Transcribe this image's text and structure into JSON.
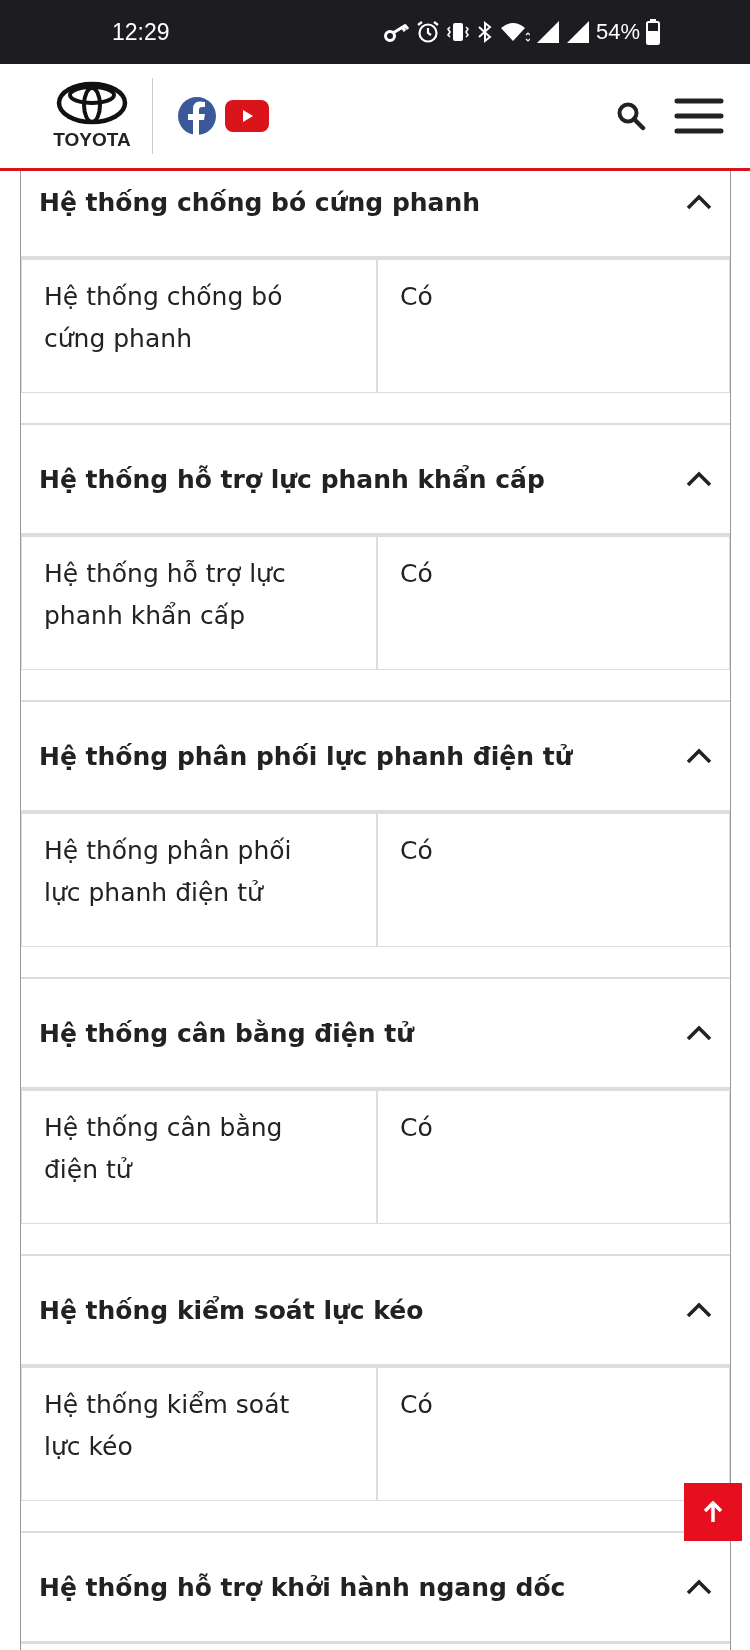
{
  "status_bar": {
    "time": "12:29",
    "battery": "54%"
  },
  "header": {
    "brand": "TOYOTA"
  },
  "sections": [
    {
      "title": "Hệ thống chống bó cứng phanh",
      "expanded": true,
      "rows": [
        {
          "label": "Hệ thống chống bó cứng phanh",
          "value": "Có"
        }
      ]
    },
    {
      "title": "Hệ thống hỗ trợ lực phanh khẩn cấp",
      "expanded": true,
      "rows": [
        {
          "label": "Hệ thống hỗ trợ lực phanh khẩn cấp",
          "value": "Có"
        }
      ]
    },
    {
      "title": "Hệ thống phân phối lực phanh điện tử",
      "expanded": true,
      "rows": [
        {
          "label": "Hệ thống phân phối lực phanh điện tử",
          "value": "Có"
        }
      ]
    },
    {
      "title": "Hệ thống cân bằng điện tử",
      "expanded": true,
      "rows": [
        {
          "label": "Hệ thống cân bằng điện tử",
          "value": "Có"
        }
      ]
    },
    {
      "title": "Hệ thống kiểm soát lực kéo",
      "expanded": true,
      "rows": [
        {
          "label": "Hệ thống kiểm soát lực kéo",
          "value": "Có"
        }
      ]
    },
    {
      "title": "Hệ thống hỗ trợ khởi hành ngang dốc",
      "expanded": true
    }
  ]
}
